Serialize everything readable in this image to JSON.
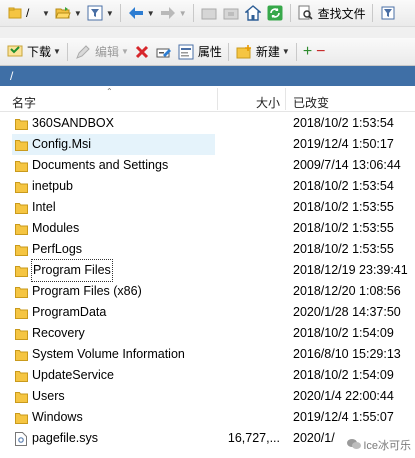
{
  "toolbar1": {
    "path_value": "/",
    "search_files_label": "查找文件"
  },
  "toolbar2": {
    "download_label": "下载",
    "edit_label": "编辑",
    "properties_label": "属性",
    "new_label": "新建"
  },
  "path_bar": {
    "path": "/"
  },
  "columns": {
    "name": "名字",
    "size": "大小",
    "modified": "已改变"
  },
  "files": [
    {
      "name": "360SANDBOX",
      "size": "",
      "modified": "2018/10/2 1:53:54",
      "type": "folder"
    },
    {
      "name": "Config.Msi",
      "size": "",
      "modified": "2019/12/4 1:50:17",
      "type": "folder"
    },
    {
      "name": "Documents and Settings",
      "size": "",
      "modified": "2009/7/14 13:06:44",
      "type": "folder"
    },
    {
      "name": "inetpub",
      "size": "",
      "modified": "2018/10/2 1:53:54",
      "type": "folder"
    },
    {
      "name": "Intel",
      "size": "",
      "modified": "2018/10/2 1:53:55",
      "type": "folder"
    },
    {
      "name": "Modules",
      "size": "",
      "modified": "2018/10/2 1:53:55",
      "type": "folder"
    },
    {
      "name": "PerfLogs",
      "size": "",
      "modified": "2018/10/2 1:53:55",
      "type": "folder"
    },
    {
      "name": "Program Files",
      "size": "",
      "modified": "2018/12/19 23:39:41",
      "type": "folder"
    },
    {
      "name": "Program Files (x86)",
      "size": "",
      "modified": "2018/12/20 1:08:56",
      "type": "folder"
    },
    {
      "name": "ProgramData",
      "size": "",
      "modified": "2020/1/28 14:37:50",
      "type": "folder"
    },
    {
      "name": "Recovery",
      "size": "",
      "modified": "2018/10/2 1:54:09",
      "type": "folder"
    },
    {
      "name": "System Volume Information",
      "size": "",
      "modified": "2016/8/10 15:29:13",
      "type": "folder"
    },
    {
      "name": "UpdateService",
      "size": "",
      "modified": "2018/10/2 1:54:09",
      "type": "folder"
    },
    {
      "name": "Users",
      "size": "",
      "modified": "2020/1/4 22:00:44",
      "type": "folder"
    },
    {
      "name": "Windows",
      "size": "",
      "modified": "2019/12/4 1:55:07",
      "type": "folder"
    },
    {
      "name": "pagefile.sys",
      "size": "16,727,...",
      "modified": "2020/1/",
      "type": "file"
    }
  ],
  "watermark": "Ice冰可乐",
  "colors": {
    "path_bar": "#3f6fa6",
    "folder": "#f5c542",
    "highlight_row": "#e5f3fb"
  }
}
